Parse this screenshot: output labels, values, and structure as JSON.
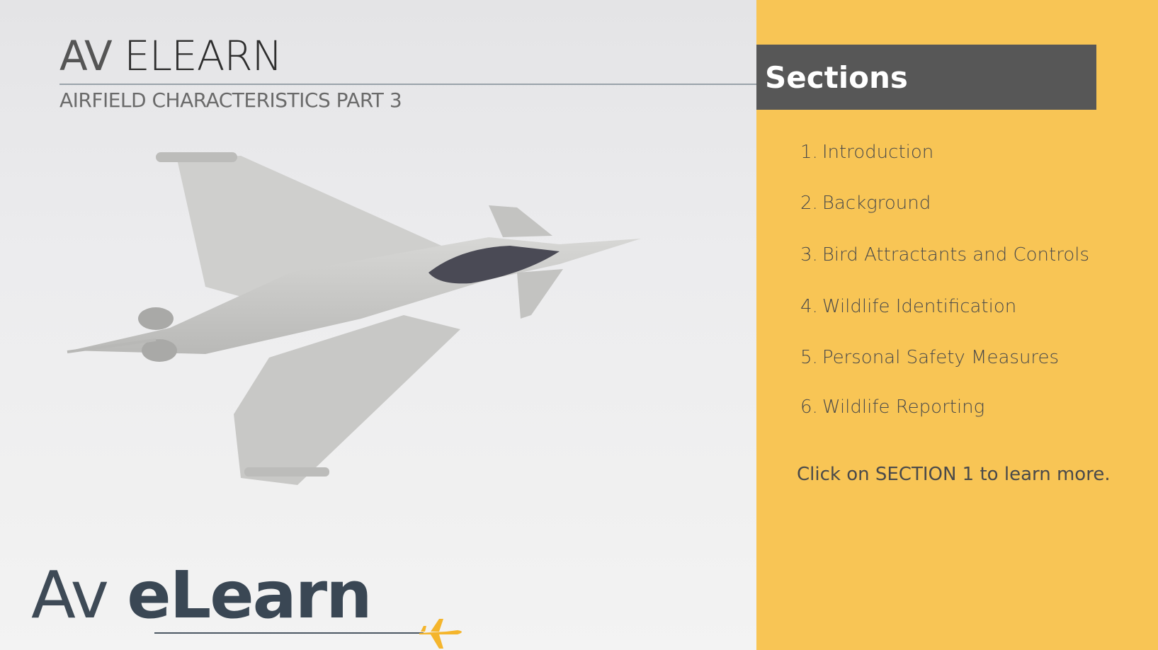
{
  "header": {
    "title_light": "AV",
    "title_main": "ELEARN",
    "subtitle": "AIRFIELD CHARACTERISTICS PART 3"
  },
  "brand": {
    "prefix": "Av",
    "name": "eLearn",
    "logo_icon": "plane-icon",
    "accent_color": "#f8c555"
  },
  "panel": {
    "title": "Sections",
    "background_color": "#f8c555",
    "header_color": "#575757",
    "items": [
      {
        "number": "1.",
        "label": "Introduction"
      },
      {
        "number": "2.",
        "label": "Background"
      },
      {
        "number": "3.",
        "label": "Bird Attractants and Controls"
      },
      {
        "number": "4.",
        "label": "Wildlife Identification"
      },
      {
        "number": "5.",
        "label": "Personal Safety Measures"
      },
      {
        "number": "6.",
        "label": "Wildlife Reporting"
      }
    ],
    "hint": "Click on SECTION 1 to learn more."
  },
  "hero": {
    "image_icon": "fighter-jet-illustration"
  }
}
